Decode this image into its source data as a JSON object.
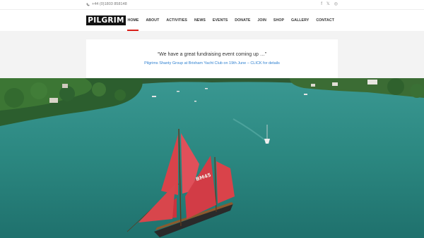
{
  "topbar": {
    "phone": "+44 (0)1803 858148",
    "social_icons": [
      "facebook-icon",
      "x-icon",
      "instagram-icon"
    ]
  },
  "header": {
    "logo": "PILGRIM",
    "nav": [
      {
        "label": "HOME",
        "active": true
      },
      {
        "label": "ABOUT",
        "active": false
      },
      {
        "label": "ACTIVITIES",
        "active": false
      },
      {
        "label": "NEWS",
        "active": false
      },
      {
        "label": "EVENTS",
        "active": false
      },
      {
        "label": "DONATE",
        "active": false
      },
      {
        "label": "JOIN",
        "active": false
      },
      {
        "label": "SHOP",
        "active": false
      },
      {
        "label": "GALLERY",
        "active": false
      },
      {
        "label": "CONTACT",
        "active": false
      }
    ]
  },
  "announcement": {
    "quote": "“We have a great fundraising event coming up …”",
    "link": "Pilgrims Shanty Group at Brixham Yacht Club on 19th June – CLICK for details"
  },
  "hero": {
    "boat_sail_number": "BM45"
  },
  "colors": {
    "accent": "#d91e18",
    "link": "#2f80d0",
    "band": "#f3f3f3",
    "water": "#2e8c86",
    "sails": "#d9434a"
  }
}
